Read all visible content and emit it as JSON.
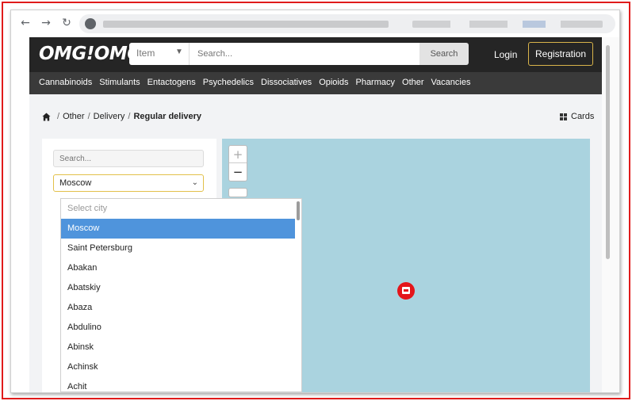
{
  "site": {
    "logo": "OMG!OMG!",
    "item_select": "Item",
    "search_placeholder": "Search...",
    "search_button": "Search",
    "login": "Login",
    "registration": "Registration"
  },
  "categories": [
    "Cannabinoids",
    "Stimulants",
    "Entactogens",
    "Psychedelics",
    "Dissociatives",
    "Opioids",
    "Pharmacy",
    "Other",
    "Vacancies"
  ],
  "breadcrumb": {
    "items": [
      "Other",
      "Delivery"
    ],
    "current": "Regular delivery"
  },
  "view_toggle": "Cards",
  "filter": {
    "search_placeholder": "Search...",
    "city_value": "Moscow"
  },
  "city_dropdown": {
    "placeholder": "Select city",
    "options": [
      "Moscow",
      "Saint Petersburg",
      "Abakan",
      "Abatskiy",
      "Abaza",
      "Abdulino",
      "Abinsk",
      "Achinsk",
      "Achit"
    ],
    "selected": "Moscow"
  },
  "map": {
    "zoom_in": "+",
    "zoom_out": "−"
  },
  "colors": {
    "accent_red": "#e01b1b",
    "topbar": "#252525",
    "catbar": "#3a3a3a",
    "registration_border": "#d9b44a",
    "map_water": "#aad3df",
    "dropdown_selected": "#4f94dc",
    "marker": "#e4151a"
  },
  "icons": {
    "back": "arrow-left-icon",
    "forward": "arrow-right-icon",
    "reload": "reload-icon",
    "home": "home-icon",
    "cards": "grid-icon",
    "marker": "shop-marker-icon"
  }
}
